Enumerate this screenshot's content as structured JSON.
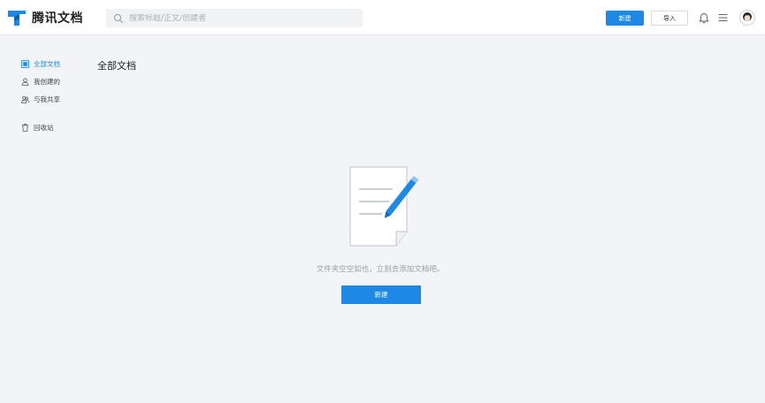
{
  "app": {
    "name": "腾讯文档",
    "brand_color": "#1e88e5",
    "logo_icon": "tencent-docs-logo-icon"
  },
  "header": {
    "search_placeholder": "搜索标题/正文/创建者",
    "new_label": "新建",
    "import_label": "导入",
    "icons": [
      "search-icon",
      "bell-icon",
      "menu-icon",
      "avatar"
    ]
  },
  "sidebar": {
    "items": [
      {
        "label": "全部文档",
        "icon": "all-docs-icon",
        "active": true
      },
      {
        "label": "我创建的",
        "icon": "user-icon",
        "active": false
      },
      {
        "label": "与我共享",
        "icon": "shared-users-icon",
        "active": false
      },
      {
        "label": "回收站",
        "icon": "trash-icon",
        "active": false
      }
    ]
  },
  "main": {
    "title": "全部文档",
    "empty_illustration": "document-pencil-icon",
    "empty_message": "文件夹空空如也，立刻去添加文档吧。",
    "new_label": "新建"
  }
}
